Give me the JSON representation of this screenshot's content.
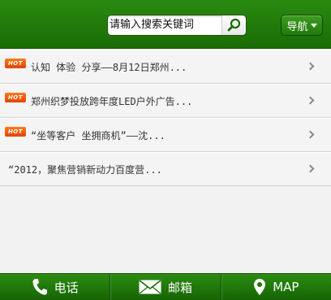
{
  "header": {
    "search_placeholder": "请输入搜索关键词",
    "nav_label": "导航"
  },
  "list": [
    {
      "hot": true,
      "text": "认知 体验 分享——8月12日郑州..."
    },
    {
      "hot": true,
      "text": "郑州织梦投放跨年度LED户外广告..."
    },
    {
      "hot": true,
      "text": "“坐等客户 坐拥商机”——沈..."
    },
    {
      "hot": false,
      "text": "“2012，聚焦营销新动力百度营..."
    }
  ],
  "hot_label": "HOT",
  "footer": {
    "phone_label": "电话",
    "mail_label": "邮箱",
    "map_label": "MAP"
  },
  "colors": {
    "header_green": "#1f7a0a",
    "hot_orange": "#f05a00"
  },
  "icons": [
    "search-icon",
    "phone-icon",
    "mail-icon",
    "map-pin-icon"
  ]
}
